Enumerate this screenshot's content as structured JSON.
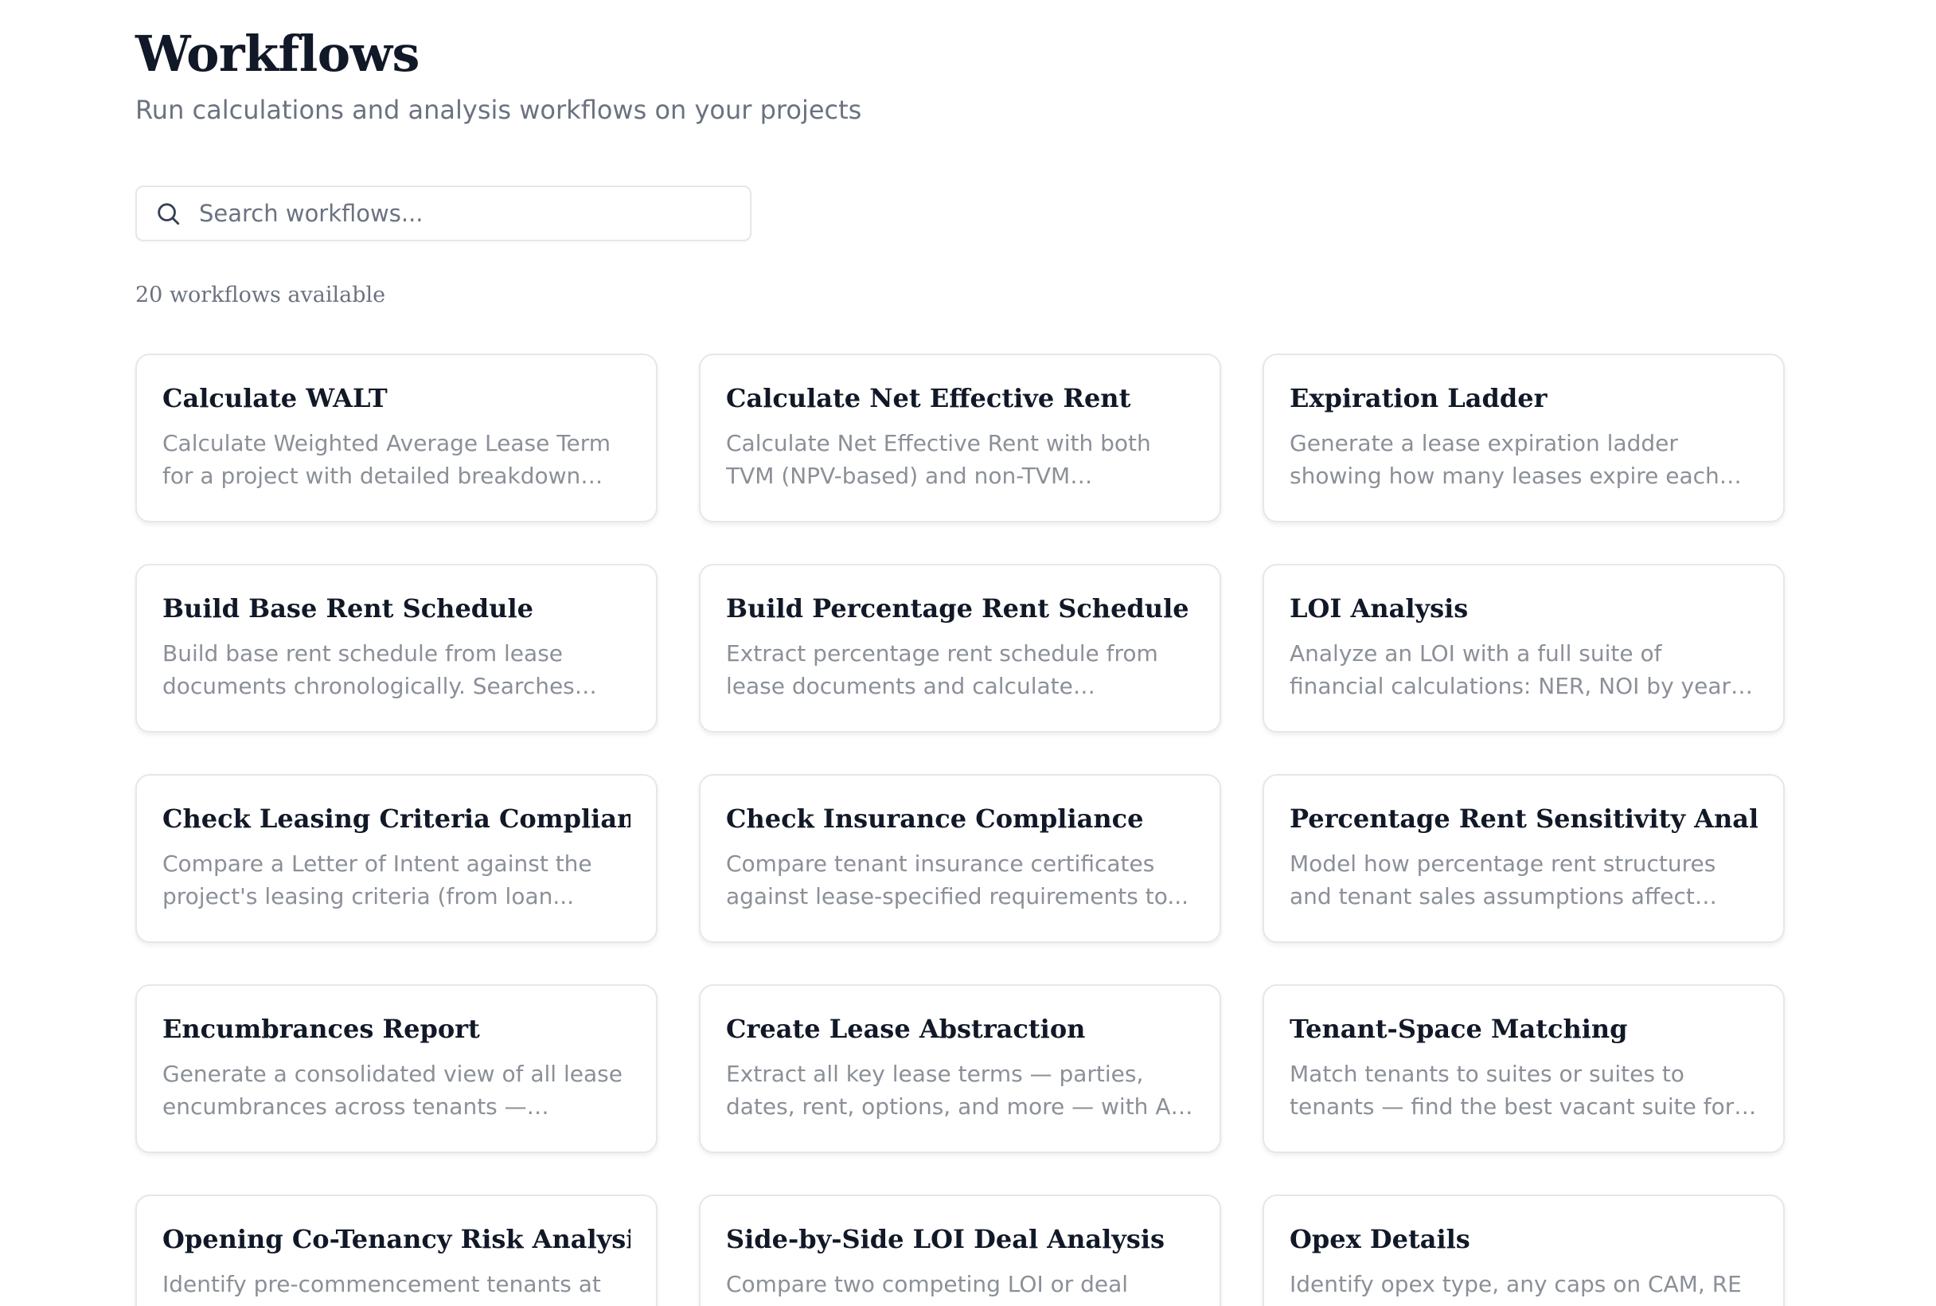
{
  "header": {
    "title": "Workflows",
    "subtitle": "Run calculations and analysis workflows on your projects"
  },
  "search": {
    "placeholder": "Search workflows...",
    "value": "",
    "icon": "search-icon"
  },
  "summary": {
    "count_text": "20 workflows available"
  },
  "workflows": [
    {
      "title": "Calculate WALT",
      "description": "Calculate Weighted Average Lease Term for a project with detailed breakdown by..."
    },
    {
      "title": "Calculate Net Effective Rent",
      "description": "Calculate Net Effective Rent with both TVM (NPV-based) and non-TVM methods,..."
    },
    {
      "title": "Expiration Ladder",
      "description": "Generate a lease expiration ladder showing how many leases expire each year with..."
    },
    {
      "title": "Build Base Rent Schedule",
      "description": "Build base rent schedule from lease documents chronologically. Searches mai..."
    },
    {
      "title": "Build Percentage Rent Schedule",
      "description": "Extract percentage rent schedule from lease documents and calculate estimated..."
    },
    {
      "title": "LOI Analysis",
      "description": "Analyze an LOI with a full suite of financial calculations: NER, NOI by year, total deal..."
    },
    {
      "title": "Check Leasing Criteria Compliance",
      "description": "Compare a Letter of Intent against the project's leasing criteria (from loan..."
    },
    {
      "title": "Check Insurance Compliance",
      "description": "Compare tenant insurance certificates against lease-specified requirements to..."
    },
    {
      "title": "Percentage Rent Sensitivity Analysis",
      "description": "Model how percentage rent structures and tenant sales assumptions affect revenue,..."
    },
    {
      "title": "Encumbrances Report",
      "description": "Generate a consolidated view of all lease encumbrances across tenants — renewal..."
    },
    {
      "title": "Create Lease Abstraction",
      "description": "Extract all key lease terms — parties, dates, rent, options, and more — with AI-powere..."
    },
    {
      "title": "Tenant-Space Matching",
      "description": "Match tenants to suites or suites to tenants — find the best vacant suite for a prospec..."
    },
    {
      "title": "Opening Co-Tenancy Risk Analysis",
      "description": "Identify pre-commencement tenants at risk of early termination due to opening co-"
    },
    {
      "title": "Side-by-Side LOI Deal Analysis",
      "description": "Compare two competing LOI or deal scenarios side by side with full financial"
    },
    {
      "title": "Opex Details",
      "description": "Identify opex type, any caps on CAM, RE Taxes, and Insurance"
    }
  ]
}
